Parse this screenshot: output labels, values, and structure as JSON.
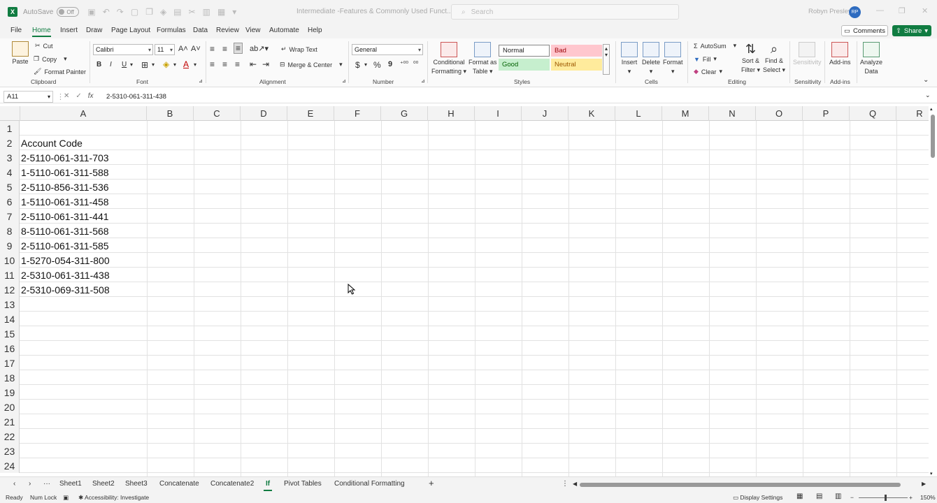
{
  "titlebar": {
    "autosave_label": "AutoSave",
    "autosave_state": "Off",
    "document_title": "Intermediate -Features & Commonly Used Funct...",
    "search_placeholder": "Search",
    "user_name": "Robyn Presley",
    "user_initials": "RP"
  },
  "menu": {
    "tabs": [
      "File",
      "Home",
      "Insert",
      "Draw",
      "Page Layout",
      "Formulas",
      "Data",
      "Review",
      "View",
      "Automate",
      "Help"
    ],
    "active": "Home",
    "comments_label": "Comments",
    "share_label": "Share"
  },
  "ribbon": {
    "clipboard": {
      "paste": "Paste",
      "cut": "Cut",
      "copy": "Copy",
      "format_painter": "Format Painter",
      "label": "Clipboard"
    },
    "font": {
      "name": "Calibri",
      "size": "11",
      "bold": "B",
      "italic": "I",
      "underline": "U",
      "label": "Font"
    },
    "alignment": {
      "wrap_text": "Wrap Text",
      "merge_center": "Merge & Center",
      "label": "Alignment"
    },
    "number": {
      "format": "General",
      "currency": "$",
      "percent": "%",
      "comma": "9",
      "label": "Number"
    },
    "styles": {
      "conditional_formatting_1": "Conditional",
      "conditional_formatting_2": "Formatting",
      "format_as_table_1": "Format as",
      "format_as_table_2": "Table",
      "normal": "Normal",
      "bad": "Bad",
      "good": "Good",
      "neutral": "Neutral",
      "label": "Styles"
    },
    "cells": {
      "insert": "Insert",
      "delete": "Delete",
      "format": "Format",
      "label": "Cells"
    },
    "editing": {
      "autosum": "AutoSum",
      "fill": "Fill",
      "clear": "Clear",
      "sort_filter_1": "Sort &",
      "sort_filter_2": "Filter",
      "find_select_1": "Find &",
      "find_select_2": "Select",
      "label": "Editing"
    },
    "sensitivity": {
      "button": "Sensitivity",
      "label": "Sensitivity"
    },
    "addins": {
      "button": "Add-ins",
      "label": "Add-ins"
    },
    "analyze": {
      "button_1": "Analyze",
      "button_2": "Data"
    }
  },
  "formula_bar": {
    "name_box": "A11",
    "fx": "fx",
    "value": "2-5310-061-311-438"
  },
  "grid": {
    "columns": [
      "A",
      "B",
      "C",
      "D",
      "E",
      "F",
      "G",
      "H",
      "I",
      "J",
      "K",
      "L",
      "M",
      "N",
      "O",
      "P",
      "Q",
      "R"
    ],
    "rows": [
      {
        "num": "1",
        "a": ""
      },
      {
        "num": "2",
        "a": "Account Code"
      },
      {
        "num": "3",
        "a": "2-5110-061-311-703"
      },
      {
        "num": "4",
        "a": "1-5110-061-311-588"
      },
      {
        "num": "5",
        "a": "2-5110-856-311-536"
      },
      {
        "num": "6",
        "a": "1-5110-061-311-458"
      },
      {
        "num": "7",
        "a": "2-5110-061-311-441"
      },
      {
        "num": "8",
        "a": "8-5110-061-311-568"
      },
      {
        "num": "9",
        "a": "2-5110-061-311-585"
      },
      {
        "num": "10",
        "a": "1-5270-054-311-800"
      },
      {
        "num": "11",
        "a": "2-5310-061-311-438"
      },
      {
        "num": "12",
        "a": "2-5310-069-311-508"
      },
      {
        "num": "13",
        "a": ""
      },
      {
        "num": "14",
        "a": ""
      },
      {
        "num": "15",
        "a": ""
      },
      {
        "num": "16",
        "a": ""
      },
      {
        "num": "17",
        "a": ""
      },
      {
        "num": "18",
        "a": ""
      },
      {
        "num": "19",
        "a": ""
      },
      {
        "num": "20",
        "a": ""
      },
      {
        "num": "21",
        "a": ""
      },
      {
        "num": "22",
        "a": ""
      },
      {
        "num": "23",
        "a": ""
      },
      {
        "num": "24",
        "a": ""
      }
    ]
  },
  "sheets": {
    "tabs": [
      "Sheet1",
      "Sheet2",
      "Sheet3",
      "Concatenate",
      "Concatenate2",
      "If",
      "Pivot Tables",
      "Conditional Formatting"
    ],
    "active": "If"
  },
  "status": {
    "ready": "Ready",
    "num_lock": "Num Lock",
    "accessibility": "Accessibility: Investigate",
    "display_settings": "Display Settings",
    "zoom": "150%"
  },
  "colors": {
    "excel_green": "#107c41",
    "bad_fill": "#ffc7ce",
    "bad_text": "#9c0006",
    "good_fill": "#c6efce",
    "good_text": "#006100",
    "neutral_fill": "#ffeb9c",
    "neutral_text": "#9c5700"
  }
}
